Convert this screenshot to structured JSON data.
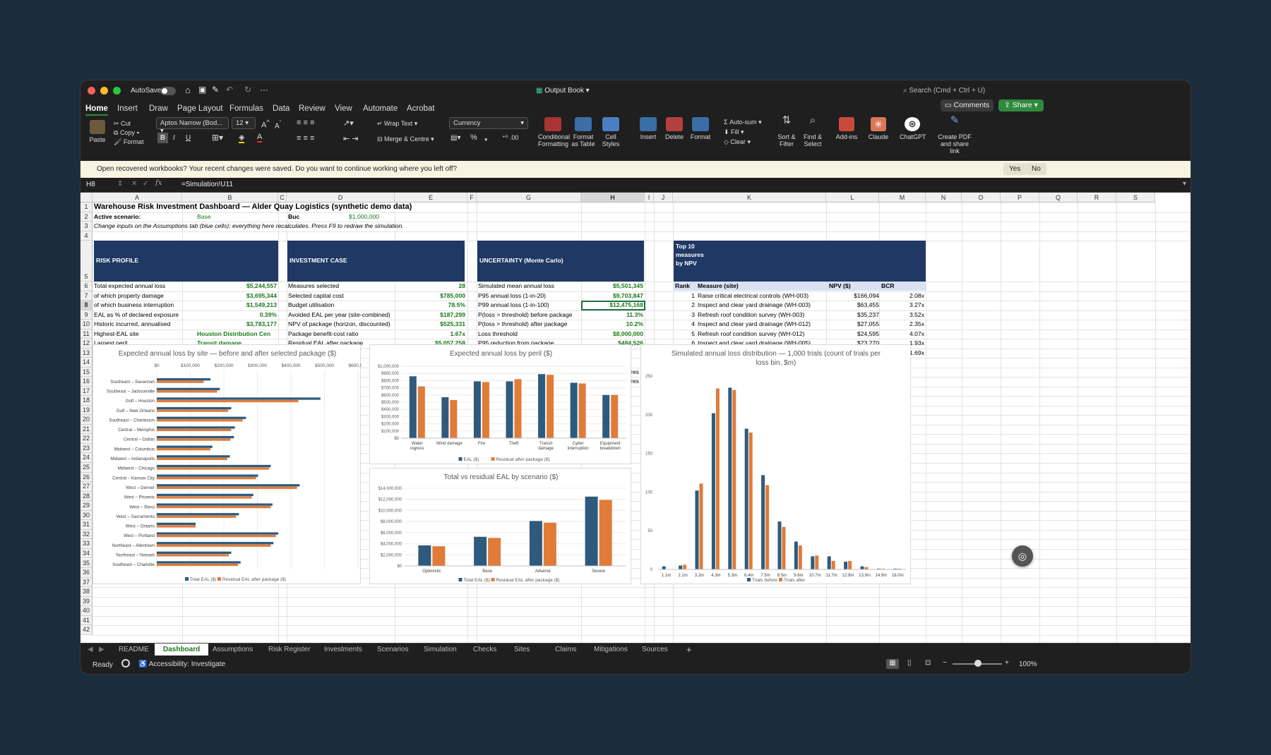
{
  "window": {
    "title": "Output Book",
    "autosave": "AutoSave",
    "search": "Search (Cmd + Ctrl + U)",
    "comments": "Comments",
    "share": "Share"
  },
  "tabs": [
    "Home",
    "Insert",
    "Draw",
    "Page Layout",
    "Formulas",
    "Data",
    "Review",
    "View",
    "Automate",
    "Acrobat"
  ],
  "ribbon": {
    "paste": "Paste",
    "cut": "Cut",
    "copy": "Copy",
    "format": "Format",
    "font": "Aptos Narrow (Bod...",
    "size": "12",
    "wrap": "Wrap Text",
    "merge": "Merge & Centre",
    "numfmt": "Currency",
    "cond": "Conditional Formatting",
    "fmttable": "Format as Table",
    "cellstyles": "Cell Styles",
    "insert": "Insert",
    "delete": "Delete",
    "formatb": "Format",
    "autosum": "Auto-sum",
    "fill": "Fill",
    "clear": "Clear",
    "sort": "Sort & Filter",
    "find": "Find & Select",
    "addins": "Add-ins",
    "claude": "Claude",
    "chatgpt": "ChatGPT",
    "pdf": "Create PDF and share link",
    "bold": "B",
    "italic": "I",
    "underline": "U",
    "percent": "%"
  },
  "message": {
    "text": "Open recovered workbooks?  Your recent changes were saved. Do you want to continue working where you left off?",
    "yes": "Yes",
    "no": "No"
  },
  "formula": {
    "ref": "H8",
    "value": "=Simulation!U11"
  },
  "columns": [
    "A",
    "B",
    "C",
    "D",
    "E",
    "F",
    "G",
    "H",
    "I",
    "J",
    "K",
    "L",
    "M",
    "N",
    "O",
    "P",
    "Q",
    "R",
    "S"
  ],
  "rows": [
    "1",
    "2",
    "3",
    "4",
    "5",
    "6",
    "7",
    "8",
    "9",
    "10",
    "11",
    "12",
    "13",
    "14",
    "15",
    "16",
    "17",
    "18",
    "19",
    "20",
    "21",
    "22",
    "23",
    "24",
    "25",
    "26",
    "27",
    "28",
    "29",
    "30",
    "31",
    "32",
    "33",
    "34",
    "35",
    "36",
    "37",
    "38",
    "39",
    "40",
    "41",
    "42"
  ],
  "sheet": {
    "title": "Warehouse Risk Investment Dashboard — Alder Quay Logistics (synthetic demo data)",
    "scenario_label": "Active scenario:",
    "scenario_value": "Base",
    "budget_label": "Buc",
    "budget_value": "$1,000,000",
    "note": "Change inputs on the Assumptions tab (blue cells); everything here recalculates. Press F9 to redraw the simulation.",
    "risk_hdr": "RISK PROFILE",
    "inv_hdr": "INVESTMENT CASE",
    "unc_hdr": "UNCERTAINTY (Monte Carlo)",
    "top_hdr": "Top 10 measures by NPV",
    "risk": [
      [
        "Total expected annual loss",
        "$5,244,557"
      ],
      [
        " of which property damage",
        "$3,695,344"
      ],
      [
        " of which business interruption",
        "$1,549,213"
      ],
      [
        "EAL as % of declared exposure",
        "0.39%"
      ],
      [
        "Historic incurred, annualised",
        "$3,783,177"
      ],
      [
        "Highest-EAL site",
        "Houston Distribution Cen"
      ],
      [
        "Largest peril",
        "Transit damage"
      ]
    ],
    "inv": [
      [
        "Measures selected",
        "28"
      ],
      [
        "Selected capital cost",
        "$785,000"
      ],
      [
        "Budget utilisation",
        "78.5%"
      ],
      [
        "Avoided EAL per year (site-combined)",
        "$187,299"
      ],
      [
        "NPV of package (horizon, discounted)",
        "$525,331"
      ],
      [
        "Package benefit-cost ratio",
        "1.67x"
      ],
      [
        "Residual EAL after package",
        "$5,057,258"
      ]
    ],
    "unc": [
      [
        "Simulated mean annual loss",
        "$5,501,345"
      ],
      [
        "P95 annual loss (1-in-20)",
        "$9,703,847"
      ],
      [
        "P99 annual loss (1-in-100)",
        "$12,475,168"
      ],
      [
        "P(loss > threshold) before package",
        "11.3%"
      ],
      [
        "P(loss > threshold) after package",
        "10.2%"
      ],
      [
        "Loss threshold",
        "$8,000,000"
      ],
      [
        "P95 reduction from package",
        "$484,526"
      ]
    ],
    "top_cols": [
      "Rank",
      "Measure (site)",
      "NPV ($)",
      "BCR"
    ],
    "top": [
      [
        "1",
        "Raise critical electrical controls (WH-003)",
        "$166,094",
        "2.08x"
      ],
      [
        "2",
        "Inspect and clear yard drainage (WH-003)",
        "$63,455",
        "3.27x"
      ],
      [
        "3",
        "Refresh roof condition survey (WH-003)",
        "$35,237",
        "3.52x"
      ],
      [
        "4",
        "Inspect and clear yard drainage (WH-012)",
        "$27,055",
        "2.35x"
      ],
      [
        "5",
        "Refresh roof condition survey (WH-012)",
        "$24,595",
        "4.07x"
      ],
      [
        "6",
        "Inspect and clear yard drainage (WH-005)",
        "$23,270",
        "1.93x"
      ],
      [
        "7",
        "Inspect and clear yard drainage (WH-018)",
        "$22,011",
        "1.69x"
      ]
    ],
    "overflow": [
      "res",
      "res"
    ]
  },
  "chart_data": [
    {
      "type": "bar",
      "orientation": "horizontal",
      "title": "Expected annual loss by site — before and after selected package ($)",
      "categories": [
        "Southeast – Savannah",
        "Southeast – Jacksonville",
        "Gulf – Houston",
        "Gulf – New Orleans",
        "Southeast – Charleston",
        "Central – Memphis",
        "Central – Dallas",
        "Midwest – Columbus",
        "Midwest – Indianapolis",
        "Midwest – Chicago",
        "Central – Kansas City",
        "West – Denver",
        "West – Phoenix",
        "West – Reno",
        "West – Sacramento",
        "West – Ontario",
        "West – Portland",
        "Northeast – Allentown",
        "Northeast – Newark",
        "Southeast – Charlotte"
      ],
      "series": [
        {
          "name": "Total EAL ($)",
          "color": "#2e5b7d",
          "values": [
            160000,
            188000,
            488000,
            222000,
            266000,
            233000,
            230000,
            166000,
            218000,
            340000,
            302000,
            426000,
            288000,
            345000,
            245000,
            116000,
            362000,
            348000,
            222000,
            250000
          ]
        },
        {
          "name": "Residual EAL after package ($)",
          "color": "#e07b39",
          "values": [
            140000,
            180000,
            422000,
            213000,
            256000,
            222000,
            220000,
            160000,
            210000,
            335000,
            296000,
            418000,
            283000,
            340000,
            236000,
            116000,
            355000,
            340000,
            215000,
            242000
          ]
        }
      ],
      "xticks": [
        "$0",
        "$100,000",
        "$200,000",
        "$300,000",
        "$400,000",
        "$500,000",
        "$600,000"
      ],
      "xlim": [
        0,
        600000
      ]
    },
    {
      "type": "bar",
      "title": "Expected annual loss by peril ($)",
      "categories": [
        "Water ingress",
        "Wind damage",
        "Fire",
        "Theft",
        "Transit damage",
        "Cyber interruption",
        "Equipment breakdown"
      ],
      "series": [
        {
          "name": "EAL ($)",
          "color": "#2e5b7d",
          "values": [
            860000,
            570000,
            790000,
            790000,
            890000,
            770000,
            600000
          ]
        },
        {
          "name": "Residual after package ($)",
          "color": "#e07b39",
          "values": [
            720000,
            530000,
            780000,
            820000,
            880000,
            760000,
            600000
          ]
        }
      ],
      "yticks": [
        "$0",
        "$100,000",
        "$200,000",
        "$300,000",
        "$400,000",
        "$500,000",
        "$600,000",
        "$700,000",
        "$800,000",
        "$900,000",
        "$1,000,000"
      ],
      "ylim": [
        0,
        1000000
      ]
    },
    {
      "type": "bar",
      "title": "Total vs residual EAL by scenario ($)",
      "categories": [
        "Optimistic",
        "Base",
        "Adverse",
        "Severe"
      ],
      "series": [
        {
          "name": "Total EAL ($)",
          "color": "#2e5b7d",
          "values": [
            3700000,
            5250000,
            8100000,
            12500000
          ]
        },
        {
          "name": "Residual EAL after package ($)",
          "color": "#e07b39",
          "values": [
            3550000,
            5050000,
            7800000,
            11900000
          ]
        }
      ],
      "yticks": [
        "$0",
        "$2,000,000",
        "$4,000,000",
        "$6,000,000",
        "$8,000,000",
        "$10,000,000",
        "$12,000,000",
        "$14,000,000"
      ],
      "ylim": [
        0,
        14000000
      ]
    },
    {
      "type": "bar",
      "title": "Simulated annual loss distribution — 1,000 trials (count of trials per loss bin, $m)",
      "categories": [
        "1.1m",
        "2.1m",
        "3.2m",
        "4.3m",
        "5.3m",
        "6.4m",
        "7.5m",
        "8.5m",
        "9.6m",
        "10.7m",
        "11.7m",
        "12.8m",
        "13.9m",
        "14.9m",
        "16.0m"
      ],
      "series": [
        {
          "name": "Trials before",
          "color": "#2e5b7d",
          "values": [
            4,
            5,
            102,
            202,
            235,
            182,
            122,
            62,
            36,
            17,
            17,
            10,
            4,
            1,
            1
          ]
        },
        {
          "name": "Trials after",
          "color": "#e07b39",
          "values": [
            0,
            6,
            111,
            234,
            232,
            177,
            109,
            55,
            31,
            18,
            11,
            11,
            3,
            1,
            1
          ]
        }
      ],
      "yticks": [
        "0",
        "50",
        "100",
        "150",
        "200",
        "250"
      ],
      "ylim": [
        0,
        250
      ]
    }
  ],
  "sheets": [
    "README",
    "Dashboard",
    "Assumptions",
    "Risk Register",
    "Investments",
    "Scenarios",
    "Simulation",
    "Checks",
    "Sites",
    "Claims",
    "Mitigations",
    "Sources"
  ],
  "status": {
    "ready": "Ready",
    "access": "Accessibility: Investigate",
    "zoom": "100%"
  }
}
